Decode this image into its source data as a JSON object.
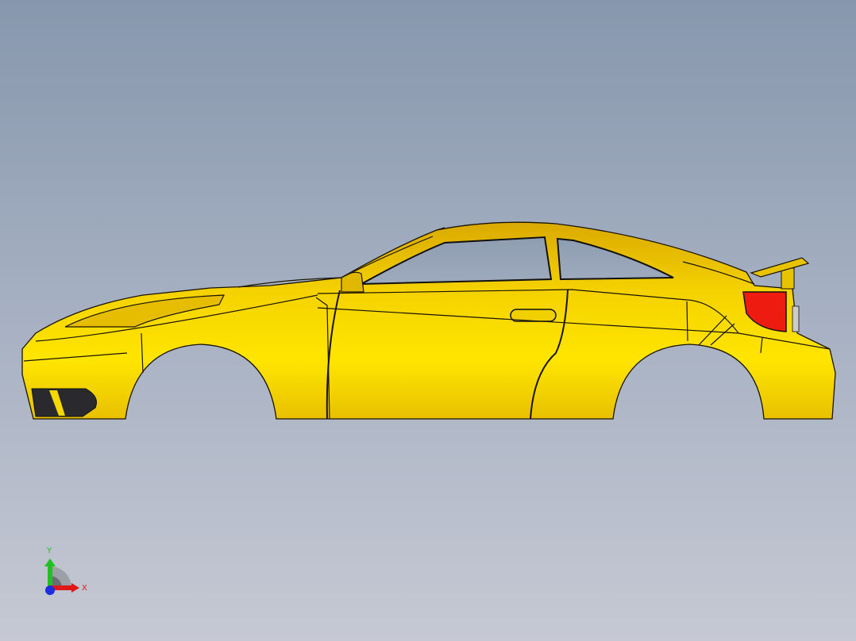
{
  "viewport": {
    "model": "car-body",
    "body_color": "#f5d800",
    "taillight_color": "#ee1c10",
    "background_top": "#8797ad",
    "background_bottom": "#c6c9d3"
  },
  "triad": {
    "x_label": "X",
    "y_label": "Y",
    "x_color": "#e01818",
    "y_color": "#22c022",
    "z_color": "#1c2ee0"
  }
}
